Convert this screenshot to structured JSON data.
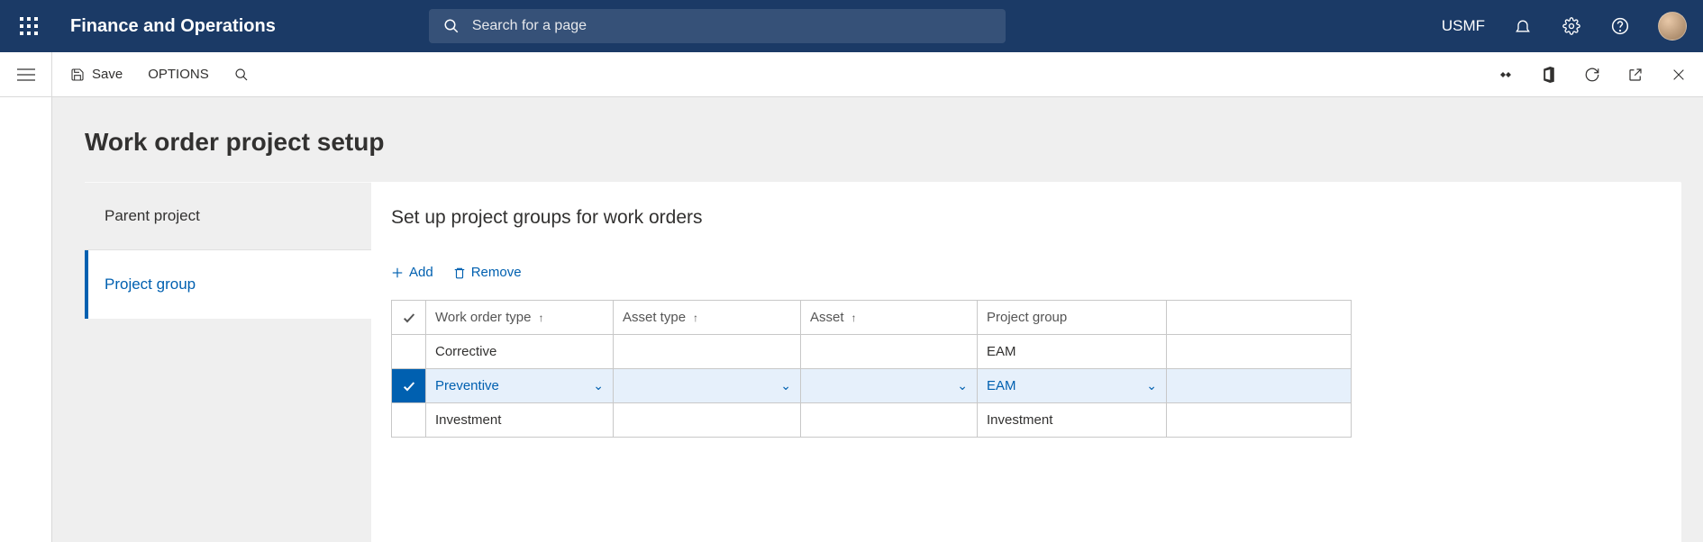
{
  "header": {
    "app_title": "Finance and Operations",
    "search_placeholder": "Search for a page",
    "company": "USMF"
  },
  "subbar": {
    "save_label": "Save",
    "options_label": "OPTIONS"
  },
  "page": {
    "title": "Work order project setup"
  },
  "side_tabs": {
    "parent_project": "Parent project",
    "project_group": "Project group"
  },
  "panel": {
    "title": "Set up project groups for work orders",
    "add_label": "Add",
    "remove_label": "Remove"
  },
  "grid": {
    "columns": {
      "work_order_type": "Work order type",
      "asset_type": "Asset type",
      "asset": "Asset",
      "project_group": "Project group"
    },
    "rows": [
      {
        "work_order_type": "Corrective",
        "asset_type": "",
        "asset": "",
        "project_group": "EAM",
        "selected": false
      },
      {
        "work_order_type": "Preventive",
        "asset_type": "",
        "asset": "",
        "project_group": "EAM",
        "selected": true
      },
      {
        "work_order_type": "Investment",
        "asset_type": "",
        "asset": "",
        "project_group": "Investment",
        "selected": false
      }
    ]
  }
}
